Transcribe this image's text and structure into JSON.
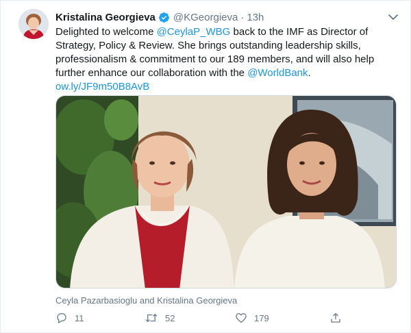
{
  "tweet": {
    "author_name": "Kristalina Georgieva",
    "verified_icon": "verified-badge-icon",
    "handle": "@KGeorgieva",
    "separator": "·",
    "time": "13h",
    "text_part1": "Delighted to welcome ",
    "mention1": "@CeylaP_WBG",
    "text_part2": " back to the IMF as Director of Strategy, Policy & Review. She brings outstanding leadership skills, professionalism & commitment to our 189 members, and will also help further enhance our collaboration with the ",
    "mention2": "@WorldBank",
    "text_part3": ".",
    "url": "ow.ly/JF9m50B8AvB",
    "caption": "Ceyla Pazarbasioglu and Kristalina Georgieva"
  },
  "actions": {
    "reply_count": "11",
    "retweet_count": "52",
    "like_count": "179"
  },
  "colors": {
    "link": "#1b95e0",
    "muted": "#657786",
    "verified": "#1da1f2"
  }
}
